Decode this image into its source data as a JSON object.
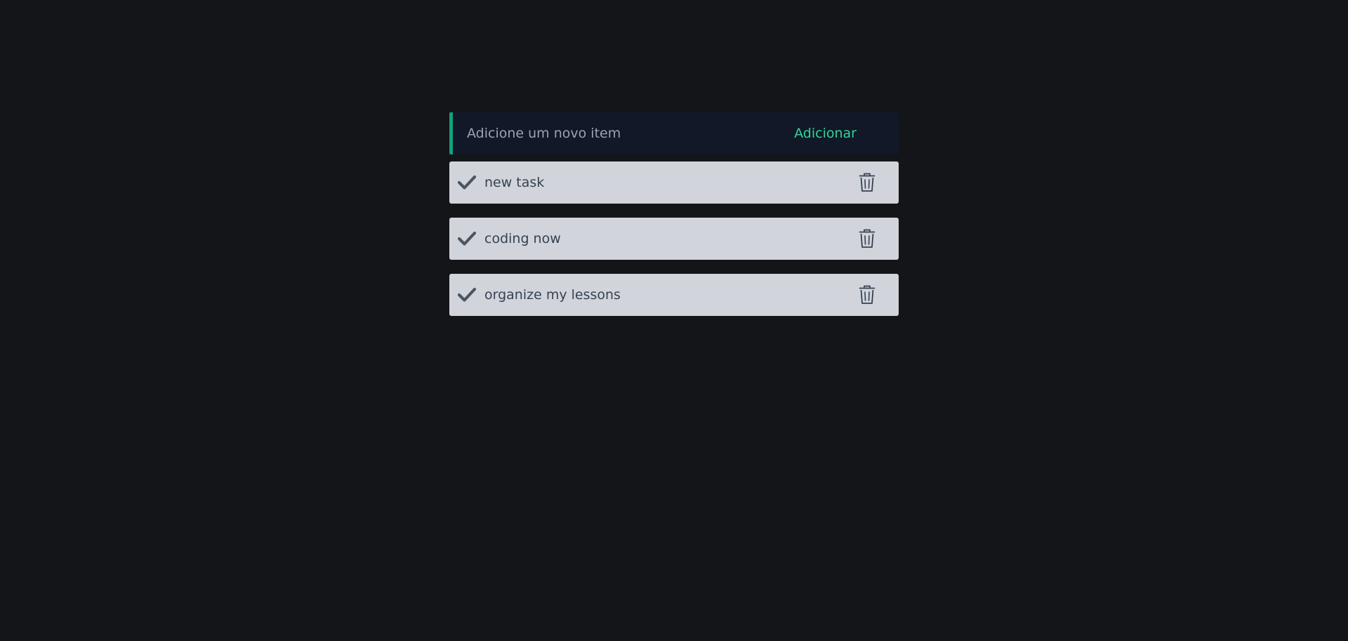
{
  "add_form": {
    "placeholder": "Adicione um novo item",
    "value": "",
    "button_label": "Adicionar"
  },
  "tasks": [
    {
      "text": "new task",
      "icon": "check-icon",
      "delete_icon": "trash-icon"
    },
    {
      "text": "coding now",
      "icon": "check-icon",
      "delete_icon": "trash-icon"
    },
    {
      "text": "organize my lessons",
      "icon": "check-icon",
      "delete_icon": "trash-icon"
    }
  ],
  "colors": {
    "background": "#141518",
    "input_background": "#111827",
    "accent": "#10a37f",
    "button_text": "#34d399",
    "task_background": "#d1d5db",
    "task_text": "#374151",
    "icon": "#4b5563"
  }
}
